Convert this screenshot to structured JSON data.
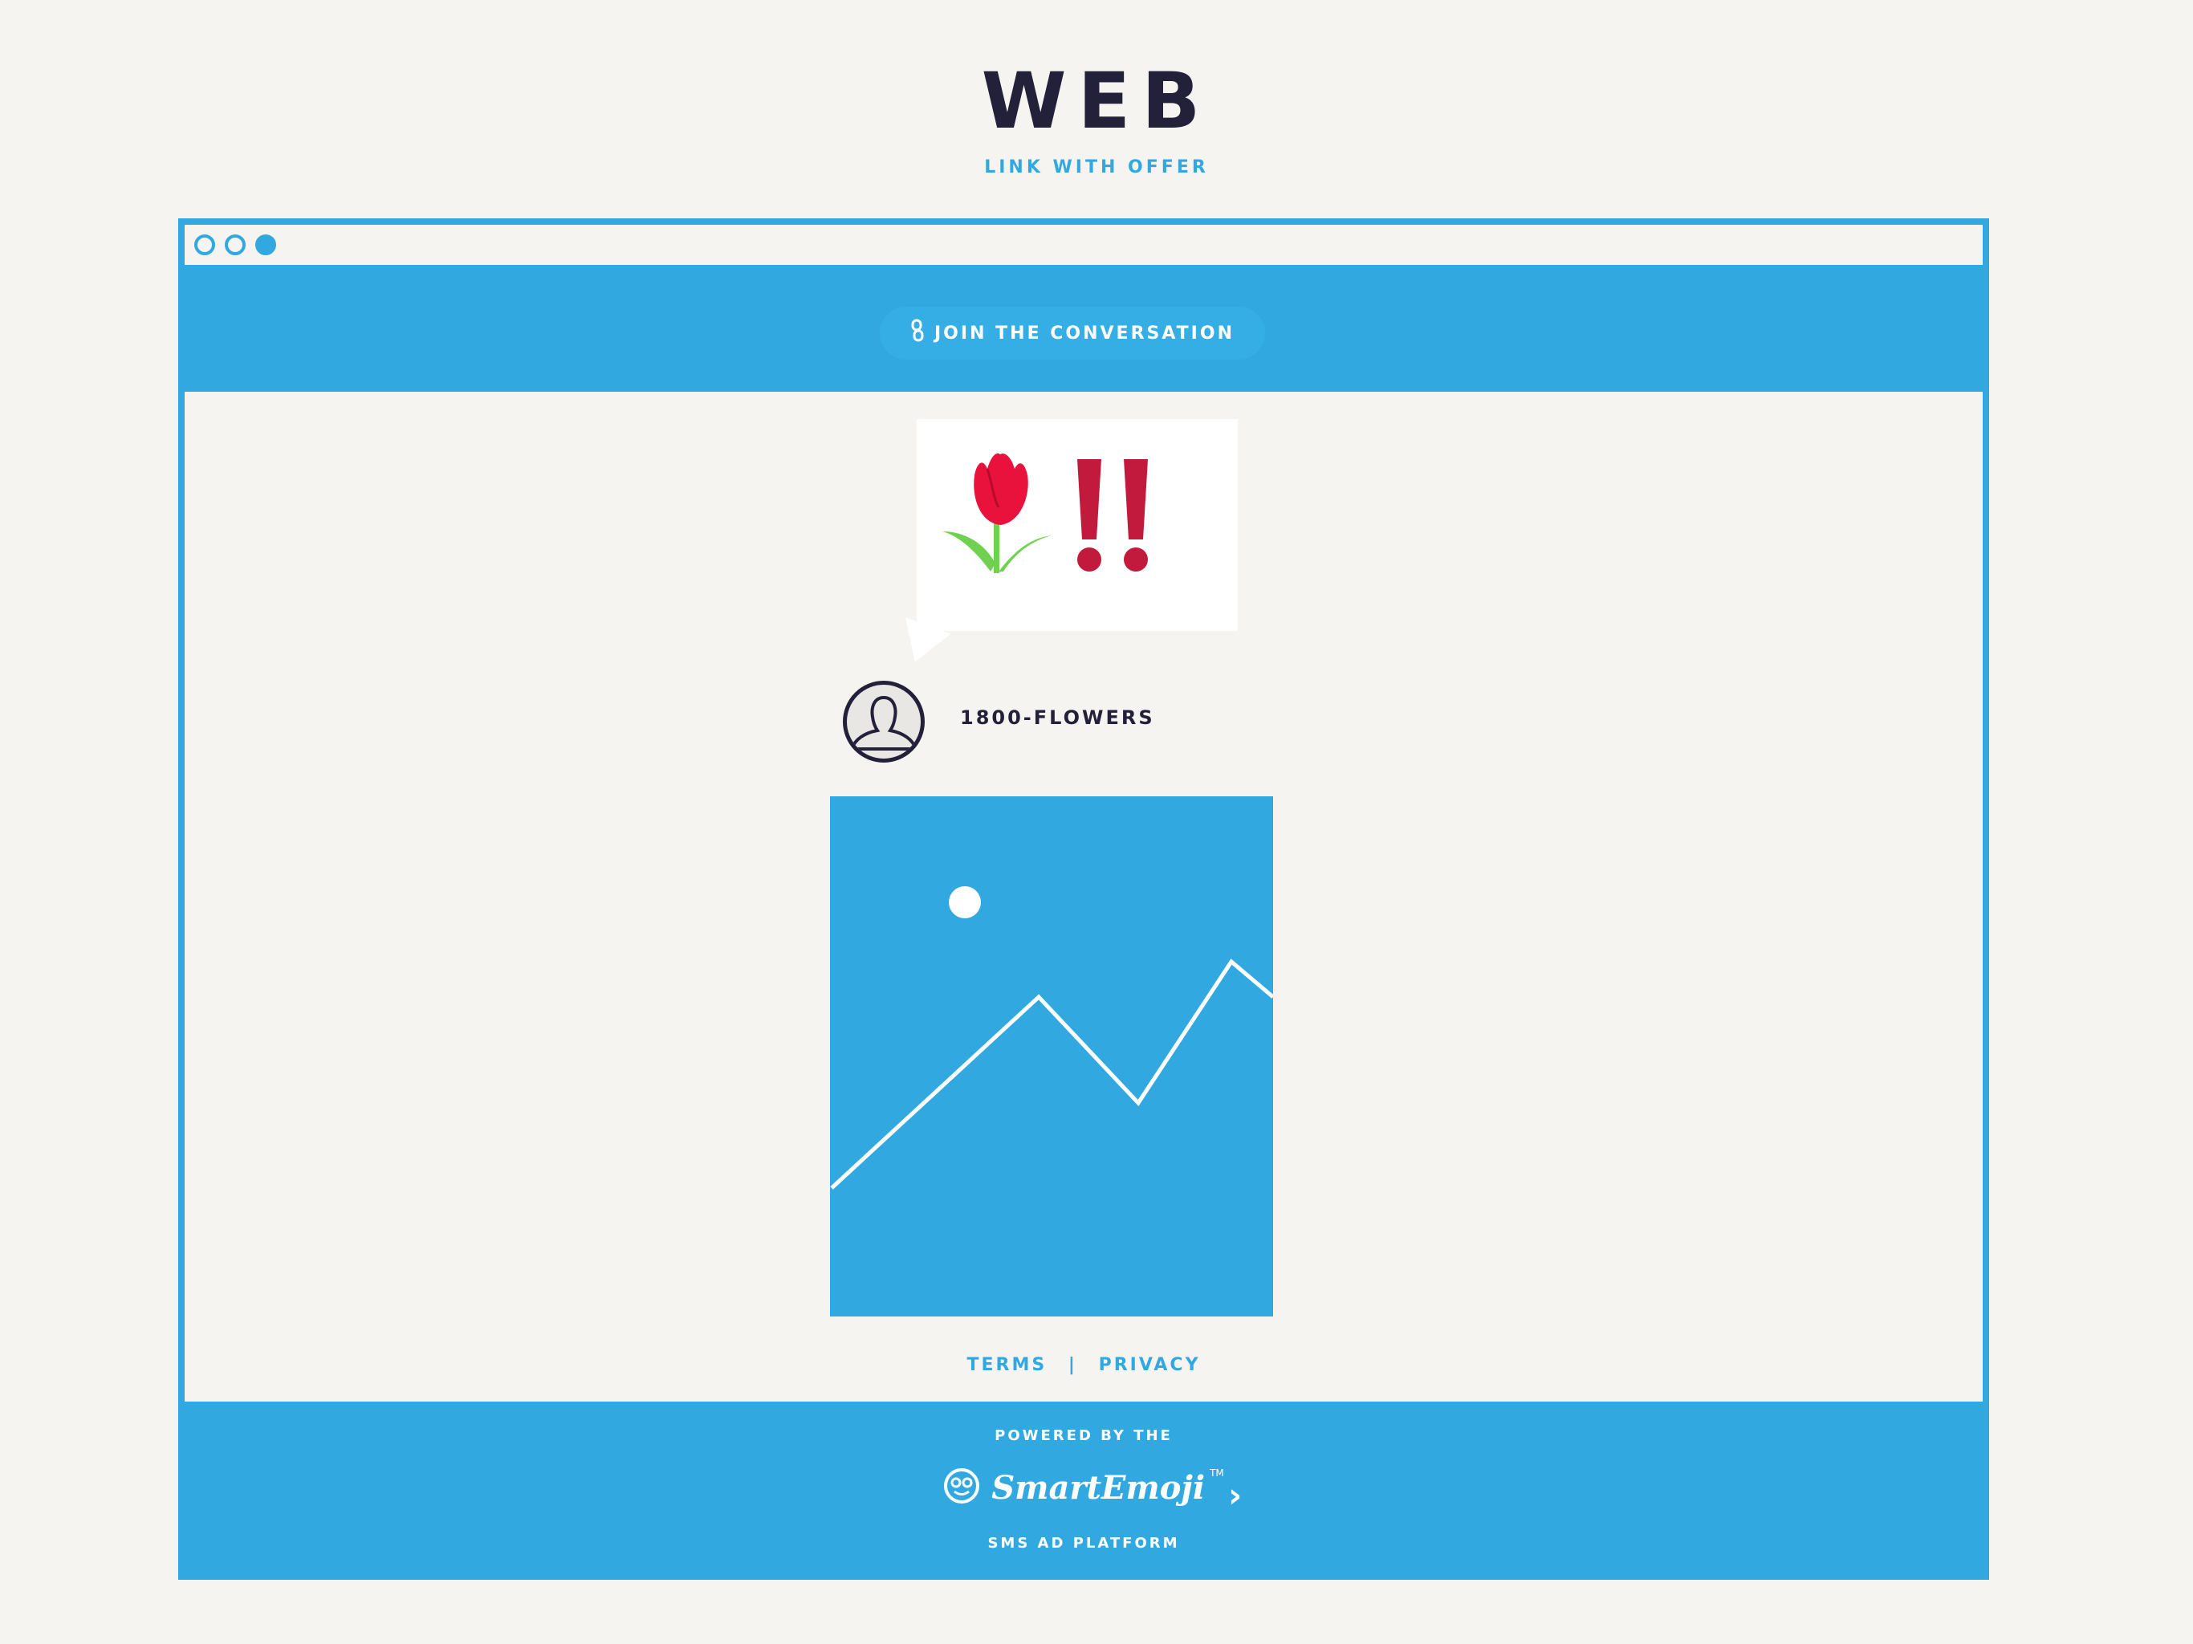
{
  "page": {
    "title": "WEB",
    "subtitle": "LINK WITH OFFER"
  },
  "header": {
    "join_label": "JOIN THE CONVERSATION",
    "join_icon": "link-icon"
  },
  "message": {
    "emoji": [
      "tulip-icon",
      "double-exclamation-icon"
    ],
    "sender": "1800-FLOWERS",
    "media_icon": "image-placeholder-icon"
  },
  "footer": {
    "terms": "TERMS",
    "separator": "|",
    "privacy": "PRIVACY",
    "powered_by": "POWERED BY THE",
    "brand": "SmartEmoji",
    "trademark": "TM",
    "tagline": "SMS AD PLATFORM"
  },
  "colors": {
    "accent": "#31a9e0",
    "background": "#f5f4f1",
    "text": "#23213a",
    "tulip": "#e8123d",
    "exclamation": "#c21a3c",
    "leaf": "#6fd14f"
  }
}
